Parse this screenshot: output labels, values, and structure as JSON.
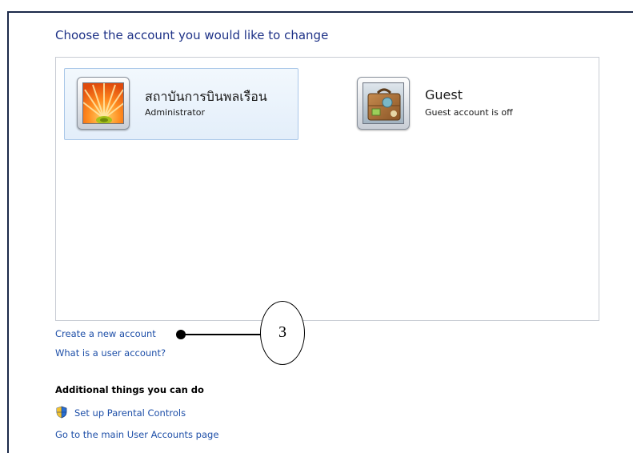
{
  "heading": "Choose the account you would like to change",
  "accounts": [
    {
      "name": "สถาบันการบินพลเรือน",
      "type": "Administrator",
      "picture": "flower-icon",
      "selected": true
    },
    {
      "name": "Guest",
      "type": "Guest account is off",
      "picture": "suitcase-icon",
      "selected": false
    }
  ],
  "links": {
    "create_account": "Create a new account",
    "what_is_account": "What is a user account?"
  },
  "additional": {
    "title": "Additional things you can do",
    "items": [
      {
        "label": "Set up Parental Controls",
        "icon": "uac-shield-icon"
      },
      {
        "label": "Go to the main User Accounts page"
      }
    ]
  },
  "callout": {
    "number": "3"
  }
}
